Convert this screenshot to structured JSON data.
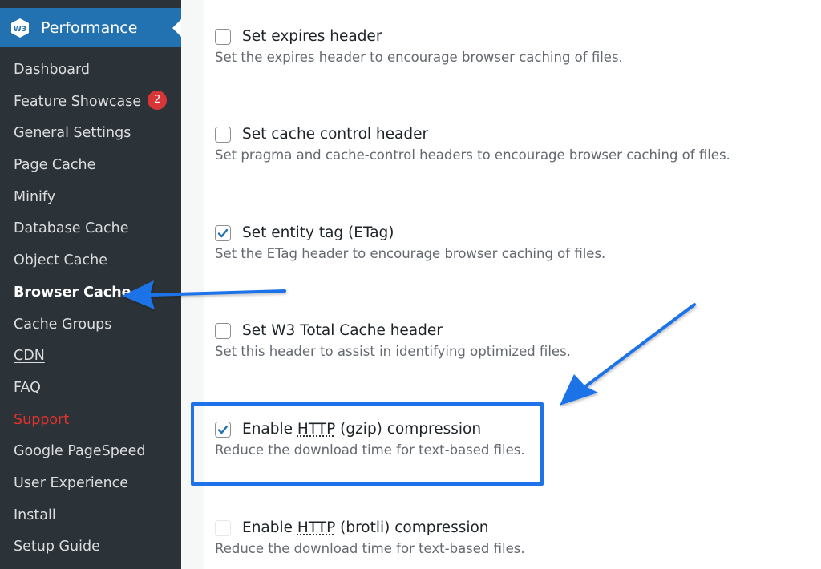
{
  "sidebar": {
    "header_title": "Performance",
    "items": [
      {
        "label": "Dashboard"
      },
      {
        "label": "Feature Showcase",
        "badge": "2"
      },
      {
        "label": "General Settings"
      },
      {
        "label": "Page Cache"
      },
      {
        "label": "Minify"
      },
      {
        "label": "Database Cache"
      },
      {
        "label": "Object Cache"
      },
      {
        "label": "Browser Cache",
        "current": true
      },
      {
        "label": "Cache Groups"
      },
      {
        "label": "CDN"
      },
      {
        "label": "FAQ"
      },
      {
        "label": "Support"
      },
      {
        "label": "Google PageSpeed"
      },
      {
        "label": "User Experience"
      },
      {
        "label": "Install"
      },
      {
        "label": "Setup Guide"
      }
    ]
  },
  "options": [
    {
      "label": "Set expires header",
      "description": "Set the expires header to encourage browser caching of files.",
      "checked": false
    },
    {
      "label": "Set cache control header",
      "description": "Set pragma and cache-control headers to encourage browser caching of files.",
      "checked": false
    },
    {
      "label": "Set entity tag (ETag)",
      "description": "Set the ETag header to encourage browser caching of files.",
      "checked": true
    },
    {
      "label": "Set W3 Total Cache header",
      "description": "Set this header to assist in identifying optimized files.",
      "checked": false
    },
    {
      "label_pre": "Enable ",
      "label_abbr": "HTTP",
      "label_post": " (gzip) compression",
      "description": "Reduce the download time for text-based files.",
      "checked": true
    },
    {
      "label_pre": "Enable ",
      "label_abbr": "HTTP",
      "label_post": " (brotli) compression",
      "description": "Reduce the download time for text-based files.",
      "checked": false,
      "disabled": true
    }
  ],
  "colors": {
    "sidebar_bg": "#2c3338",
    "header_bg": "#2271b1",
    "support_text": "#e0322b",
    "badge_bg": "#d63638",
    "annotation_blue": "#1e73e8",
    "checkmark": "#2271b1"
  },
  "icons": {
    "logo": "w3-total-cache-logo-icon",
    "check": "checkmark-icon",
    "annotation": "arrow-annotation"
  }
}
